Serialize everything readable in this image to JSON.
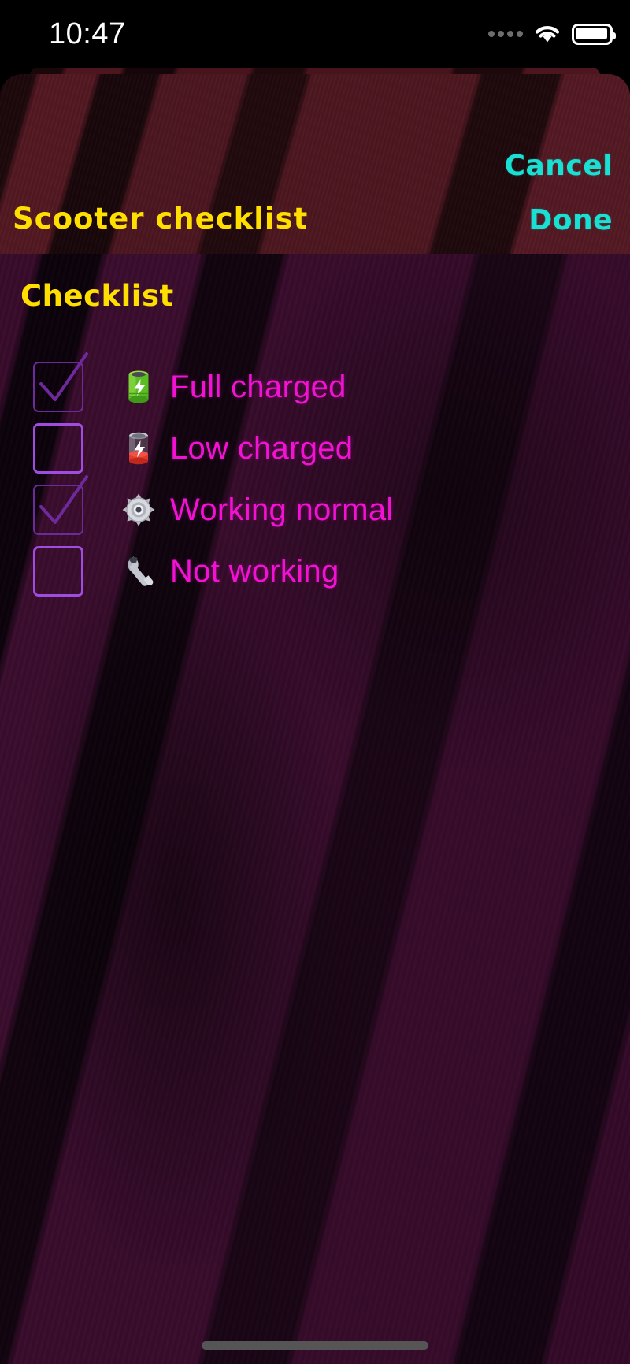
{
  "statusbar": {
    "time": "10:47",
    "signal_icon": "signal-dots-icon",
    "wifi_icon": "wifi-icon",
    "battery_icon": "battery-icon"
  },
  "header": {
    "title": "Scooter checklist",
    "cancel_label": "Cancel",
    "done_label": "Done",
    "accent_color": "#18e0d2",
    "title_color": "#ffdf00",
    "background_color": "#3f1219"
  },
  "main": {
    "section_title": "Checklist",
    "label_color": "#f312d4",
    "checkbox_on_color": "#6e2a9c",
    "checkbox_off_color": "#a14ce0",
    "background_color": "#2c0a28",
    "items": [
      {
        "label": "Full charged",
        "checked": true,
        "icon": "battery-full-green-emoji"
      },
      {
        "label": "Low charged",
        "checked": false,
        "icon": "battery-low-red-emoji"
      },
      {
        "label": "Working normal",
        "checked": true,
        "icon": "gear-emoji"
      },
      {
        "label": "Not working",
        "checked": false,
        "icon": "wrench-emoji"
      }
    ]
  },
  "footer": {
    "home_indicator": "home-indicator"
  }
}
